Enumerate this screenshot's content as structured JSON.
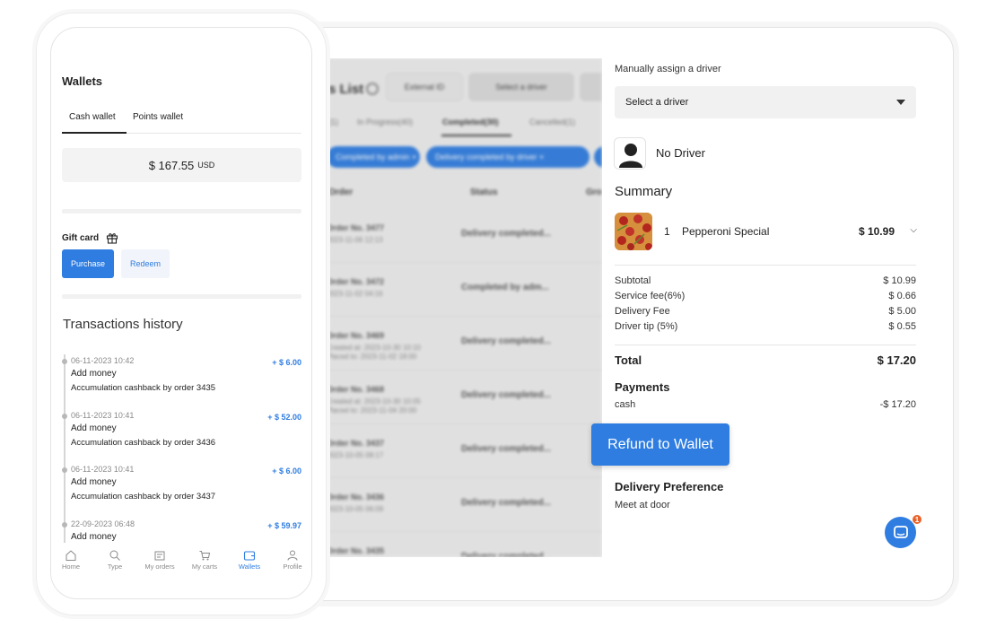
{
  "orders_panel": {
    "title": "s List",
    "filter_input": "External ID",
    "driver_select": "Select a driver",
    "tabs": [
      "(1)",
      "In Progress(40)",
      "Completed(30)",
      "Cancelled(1)"
    ],
    "chips": [
      "Completed by admin ×",
      "Delivery completed by driver ×"
    ],
    "columns": [
      "Order",
      "Status",
      "Gro"
    ],
    "rows": [
      {
        "order": "Order No. 3477",
        "sub": "2023-11-06 12:13",
        "status": "Delivery completed..."
      },
      {
        "order": "Order No. 3472",
        "sub": "2023-11-02 04:16",
        "status": "Completed by adm..."
      },
      {
        "order": "Order No. 3469",
        "sub": "Created at: 2023-10-30 10:10\nPlaced to: 2023-11-02 18:00",
        "status": "Delivery completed..."
      },
      {
        "order": "Order No. 3468",
        "sub": "Created at: 2023-10-30 10:05\nPlaced to: 2023-11-04 20:00",
        "status": "Delivery completed..."
      },
      {
        "order": "Order No. 3437",
        "sub": "2023-10-05 08:17",
        "status": "Delivery completed..."
      },
      {
        "order": "Order No. 3436",
        "sub": "2023-10-05 06:09",
        "status": "Delivery completed..."
      },
      {
        "order": "Order No. 3435",
        "sub": "2023-10-05 06:05",
        "status": "Delivery completed..."
      }
    ]
  },
  "detail": {
    "assign_label": "Manually assign a driver",
    "driver_select": "Select a driver",
    "driver_name": "No Driver",
    "summary_title": "Summary",
    "item": {
      "qty": "1",
      "name": "Pepperoni Special",
      "price": "$ 10.99"
    },
    "lines": [
      {
        "label": "Subtotal",
        "value": "$ 10.99"
      },
      {
        "label": "Service fee(6%)",
        "value": "$ 0.66"
      },
      {
        "label": "Delivery Fee",
        "value": "$ 5.00"
      },
      {
        "label": "Driver tip (5%)",
        "value": "$ 0.55"
      }
    ],
    "total_label": "Total",
    "total_value": "$ 17.20",
    "payments_title": "Payments",
    "payment_method": "cash",
    "payment_value": "-$ 17.20",
    "refund_button": "Refund to Wallet",
    "delivery_pref_title": "Delivery Preference",
    "delivery_pref_value": "Meet at door",
    "chat_badge": "1"
  },
  "phone": {
    "title": "Wallets",
    "tabs": [
      "Cash wallet",
      "Points wallet"
    ],
    "balance": "$ 167.55",
    "currency": "USD",
    "gift_card_label": "Gift card",
    "purchase_button": "Purchase",
    "redeem_button": "Redeem",
    "history_title": "Transactions history",
    "transactions": [
      {
        "date": "06-11-2023 10:42",
        "amount": "+ $ 6.00",
        "title": "Add money",
        "desc": "Accumulation cashback by order 3435"
      },
      {
        "date": "06-11-2023 10:41",
        "amount": "+ $ 52.00",
        "title": "Add money",
        "desc": "Accumulation cashback by order 3436"
      },
      {
        "date": "06-11-2023 10:41",
        "amount": "+ $ 6.00",
        "title": "Add money",
        "desc": "Accumulation cashback by order 3437"
      },
      {
        "date": "22-09-2023 06:48",
        "amount": "+ $ 59.97",
        "title": "Add money",
        "desc": ""
      }
    ],
    "nav": [
      {
        "label": "Home",
        "icon": "home-icon"
      },
      {
        "label": "Type",
        "icon": "search-icon"
      },
      {
        "label": "My orders",
        "icon": "orders-icon"
      },
      {
        "label": "My carts",
        "icon": "cart-icon"
      },
      {
        "label": "Wallets",
        "icon": "wallet-icon",
        "active": true
      },
      {
        "label": "Profile",
        "icon": "profile-icon"
      }
    ]
  },
  "colors": {
    "accent": "#2f7de1",
    "badge": "#e8632b"
  }
}
